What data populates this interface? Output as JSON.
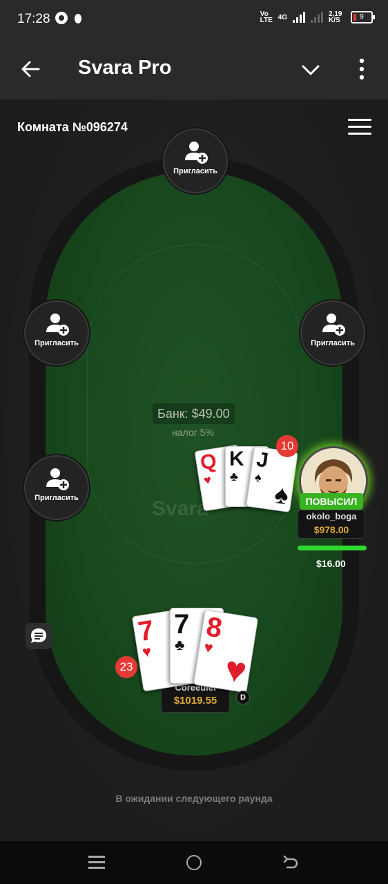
{
  "status_bar": {
    "time": "17:28",
    "network": "Vo LTE",
    "net_type": "4G",
    "speed": "2,19 K/S",
    "battery": "9"
  },
  "app_bar": {
    "title": "Svara Pro"
  },
  "room": {
    "title": "Комната №096274"
  },
  "seats": [
    {
      "label": "Пригласить"
    },
    {
      "label": "Пригласить"
    },
    {
      "label": "Пригласить"
    },
    {
      "label": "Пригласить"
    }
  ],
  "table": {
    "bank": "Банк: $49.00",
    "tax": "налог 5%",
    "watermark": "Svara"
  },
  "opponent": {
    "name": "okolo_boga",
    "chips": "$978.00",
    "action": "ПОВЫСИЛ",
    "bet": "$16.00",
    "score": "10",
    "cards": [
      {
        "rank": "Q",
        "suit": "♥"
      },
      {
        "rank": "K",
        "suit": "♣"
      },
      {
        "rank": "J",
        "suit": "♠"
      }
    ]
  },
  "me": {
    "name": "Coreeulel",
    "chips": "$1019.55",
    "score": "23",
    "dealer": "D",
    "cards": [
      {
        "rank": "7",
        "suit": "♥"
      },
      {
        "rank": "7",
        "suit": "♣"
      },
      {
        "rank": "8",
        "suit": "♥"
      }
    ]
  },
  "status_message": "В ожидании следующего раунда",
  "colors": {
    "felt": "#194a1e",
    "raise": "#3ab322",
    "chips": "#e0a93a",
    "score_badge": "#e53935"
  }
}
